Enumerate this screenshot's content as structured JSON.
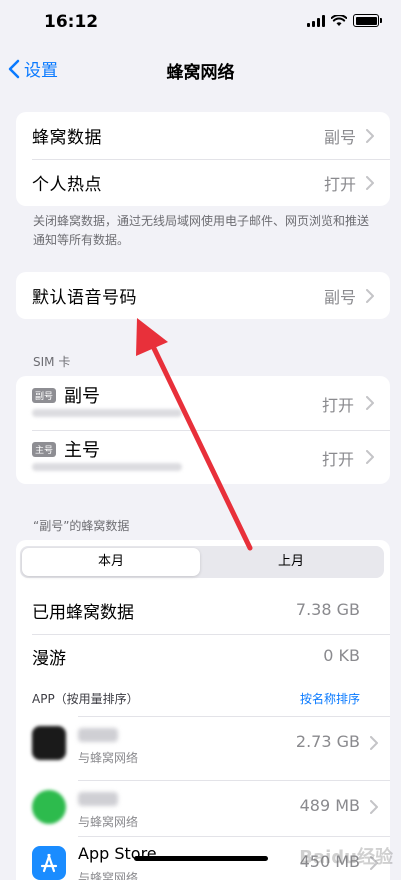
{
  "status": {
    "time": "16:12"
  },
  "nav": {
    "back_label": "设置",
    "title": "蜂窝网络"
  },
  "group1": {
    "rows": [
      {
        "label": "蜂窝数据",
        "value": "副号"
      },
      {
        "label": "个人热点",
        "value": "打开"
      }
    ],
    "footnote": "关闭蜂窝数据，通过无线局域网使用电子邮件、网页浏览和推送通知等所有数据。"
  },
  "group2": {
    "rows": [
      {
        "label": "默认语音号码",
        "value": "副号"
      }
    ]
  },
  "sim": {
    "header": "SIM 卡",
    "items": [
      {
        "badge": "副号",
        "name": "副号",
        "value": "打开"
      },
      {
        "badge": "主号",
        "name": "主号",
        "value": "打开"
      }
    ]
  },
  "usage": {
    "header": "“副号”的蜂窝数据",
    "segments": [
      "本月",
      "上月"
    ],
    "rows": [
      {
        "label": "已用蜂窝数据",
        "value": "7.38 GB"
      },
      {
        "label": "漫游",
        "value": "0 KB"
      }
    ],
    "app_header": "APP（按用量排序）",
    "sort_link": "按名称排序",
    "apps": [
      {
        "name": "",
        "sub": "与蜂窝网络",
        "value": "2.73 GB",
        "icon_color": "#1a1a1a"
      },
      {
        "name": "",
        "sub": "与蜂窝网络",
        "value": "489 MB",
        "icon_color": "#2dbb4d"
      },
      {
        "name": "App Store",
        "sub": "与蜂窝网络",
        "value": "450 MB",
        "icon_color": "#1a8cff"
      }
    ]
  },
  "watermark": "Baidu经验",
  "colors": {
    "accent": "#0a7aff",
    "arrow": "#e8303a",
    "background": "#f2f2f7"
  }
}
